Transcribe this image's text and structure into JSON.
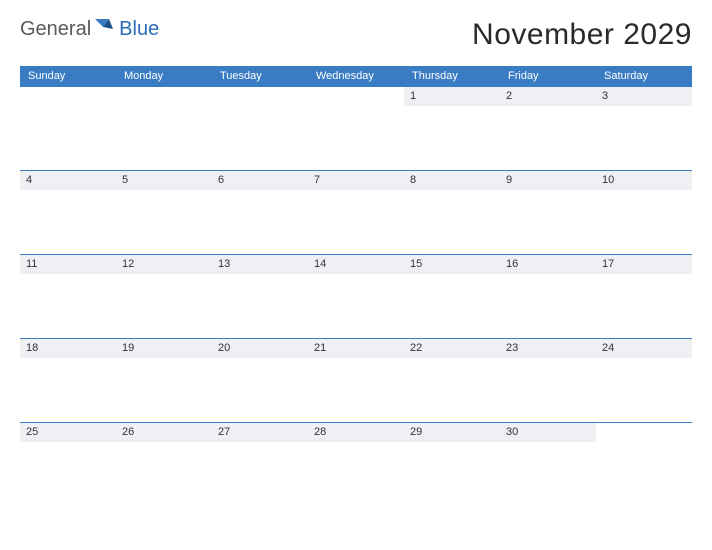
{
  "brand": {
    "part1": "General",
    "part2": "Blue"
  },
  "title": "November 2029",
  "day_names": [
    "Sunday",
    "Monday",
    "Tuesday",
    "Wednesday",
    "Thursday",
    "Friday",
    "Saturday"
  ],
  "weeks": [
    [
      "",
      "",
      "",
      "",
      "1",
      "2",
      "3"
    ],
    [
      "4",
      "5",
      "6",
      "7",
      "8",
      "9",
      "10"
    ],
    [
      "11",
      "12",
      "13",
      "14",
      "15",
      "16",
      "17"
    ],
    [
      "18",
      "19",
      "20",
      "21",
      "22",
      "23",
      "24"
    ],
    [
      "25",
      "26",
      "27",
      "28",
      "29",
      "30",
      ""
    ]
  ],
  "colors": {
    "accent": "#3a7cc4",
    "stripe": "#eef0f3"
  }
}
